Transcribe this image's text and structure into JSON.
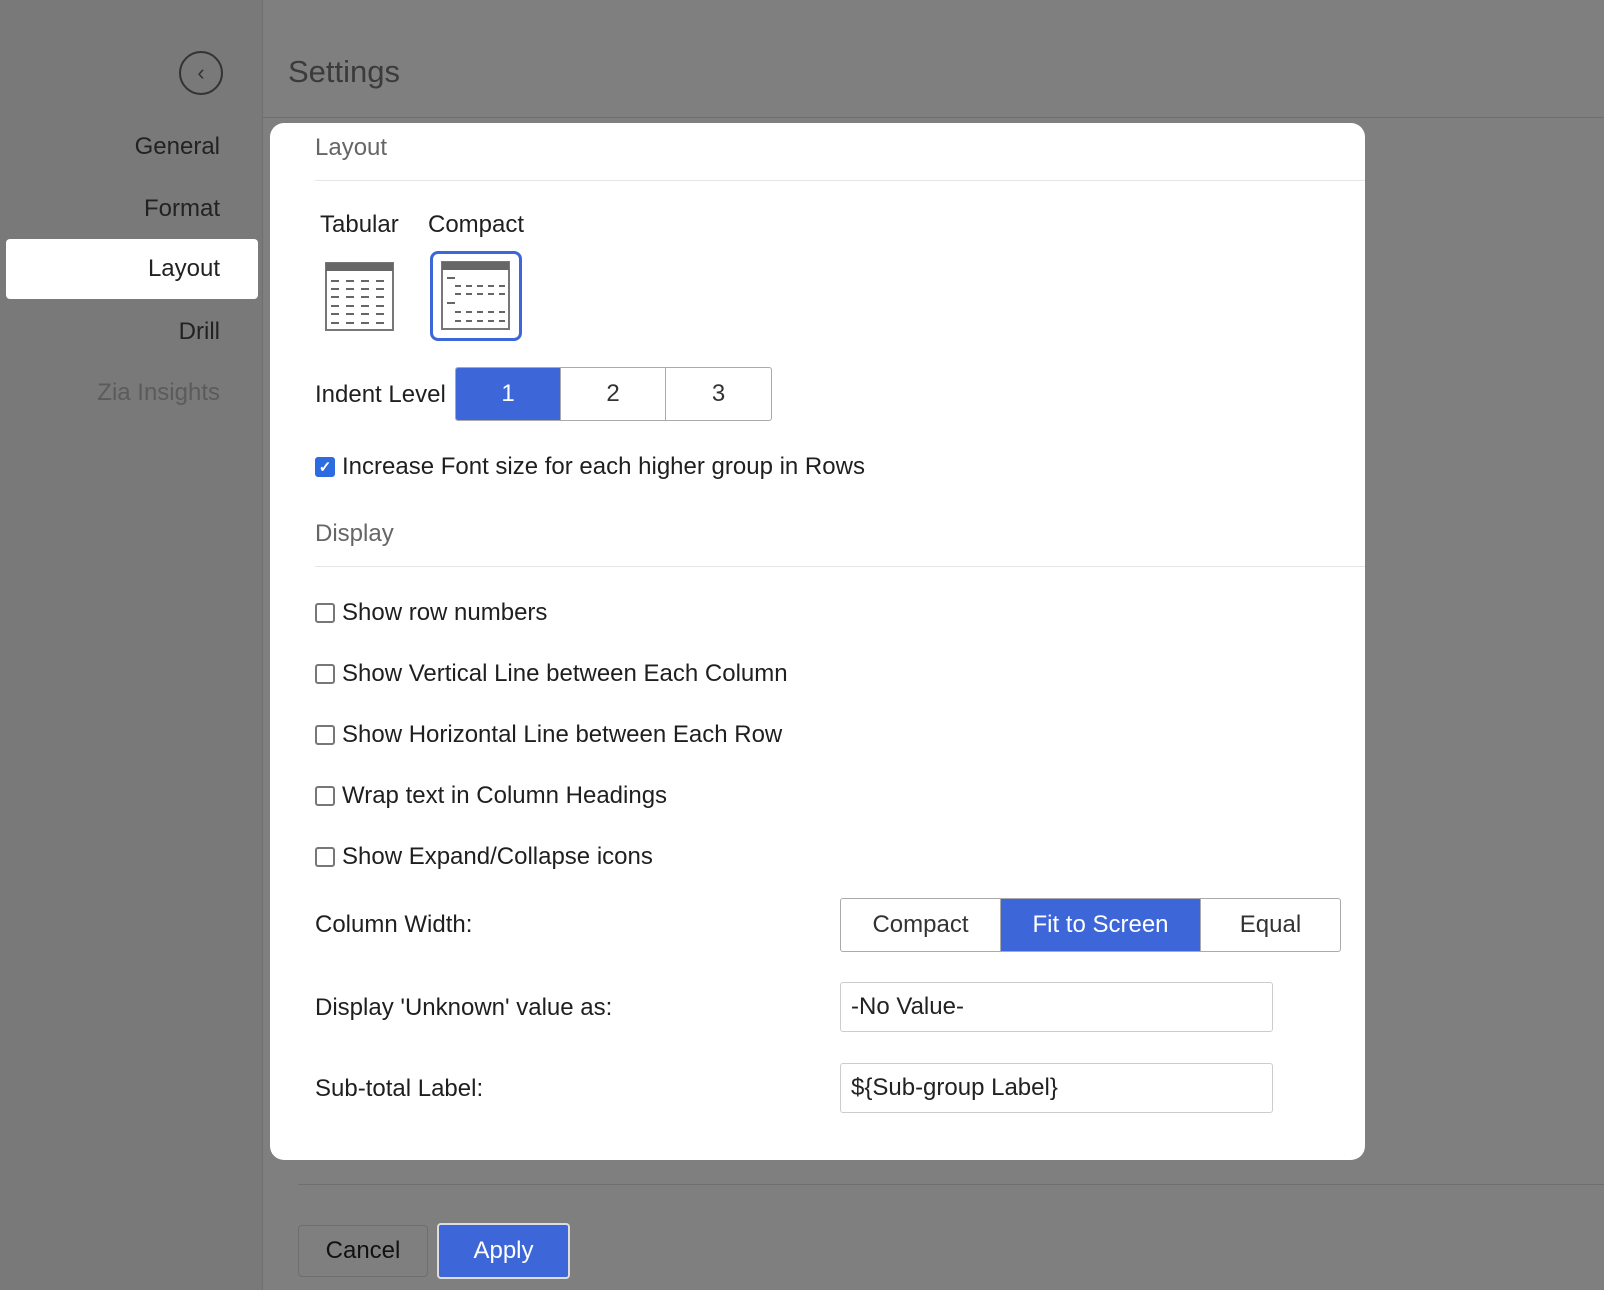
{
  "header": {
    "title": "Settings"
  },
  "sidebar": {
    "items": [
      {
        "label": "General"
      },
      {
        "label": "Format"
      },
      {
        "label": "Layout"
      },
      {
        "label": "Drill"
      },
      {
        "label": "Zia Insights"
      }
    ]
  },
  "layout": {
    "heading": "Layout",
    "options": [
      {
        "label": "Tabular"
      },
      {
        "label": "Compact"
      }
    ],
    "selected": "Compact",
    "indent_label": "Indent Level",
    "indent_options": [
      "1",
      "2",
      "3"
    ],
    "indent_selected": "1",
    "increase_font_label": "Increase Font size for each higher group in Rows",
    "increase_font_checked": true
  },
  "display": {
    "heading": "Display",
    "checkboxes": [
      {
        "label": "Show row numbers",
        "checked": false
      },
      {
        "label": "Show Vertical Line between Each Column",
        "checked": false
      },
      {
        "label": "Show Horizontal Line between Each Row",
        "checked": false
      },
      {
        "label": "Wrap text in Column Headings",
        "checked": false
      },
      {
        "label": "Show Expand/Collapse icons",
        "checked": false
      }
    ],
    "column_width_label": "Column Width:",
    "column_width_options": [
      "Compact",
      "Fit to Screen",
      "Equal"
    ],
    "column_width_selected": "Fit to Screen",
    "unknown_label": "Display 'Unknown' value as:",
    "unknown_value": "-No Value-",
    "subtotal_label": "Sub-total Label:",
    "subtotal_value": "${Sub-group Label}"
  },
  "footer": {
    "cancel": "Cancel",
    "apply": "Apply"
  },
  "colors": {
    "accent": "#3d66d8"
  }
}
